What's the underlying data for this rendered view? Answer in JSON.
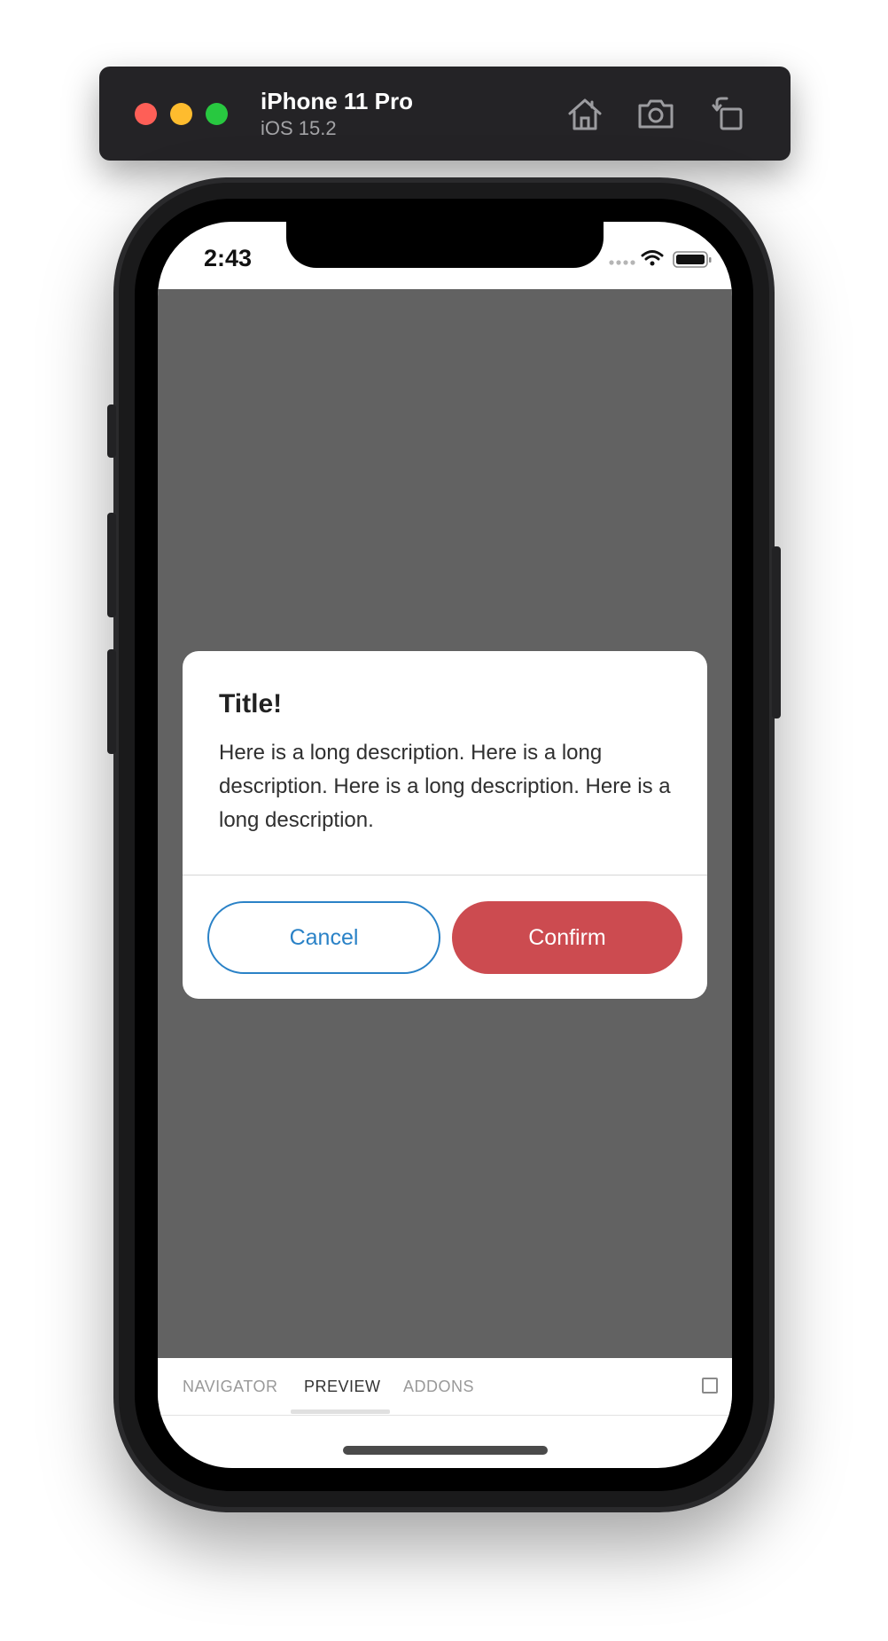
{
  "simulator": {
    "device_name": "iPhone 11 Pro",
    "os_version": "iOS 15.2",
    "toolbar_icons": [
      "home-icon",
      "screenshot-icon",
      "rotate-icon"
    ]
  },
  "status_bar": {
    "time": "2:43",
    "icons": [
      "cellular-dots-icon",
      "wifi-icon",
      "battery-icon"
    ]
  },
  "dialog": {
    "title": "Title!",
    "description": "Here is a long description. Here is a long description. Here is a long description. Here is a long description.",
    "cancel_label": "Cancel",
    "confirm_label": "Confirm"
  },
  "addon_panel": {
    "tabs": [
      {
        "label": "NAVIGATOR",
        "active": false
      },
      {
        "label": "PREVIEW",
        "active": true
      },
      {
        "label": "ADDONS",
        "active": false
      }
    ]
  },
  "colors": {
    "toolbar_bg": "#242326",
    "overlay": "#626262",
    "cancel_accent": "#2a82c7",
    "confirm_bg": "#cc4b50"
  }
}
